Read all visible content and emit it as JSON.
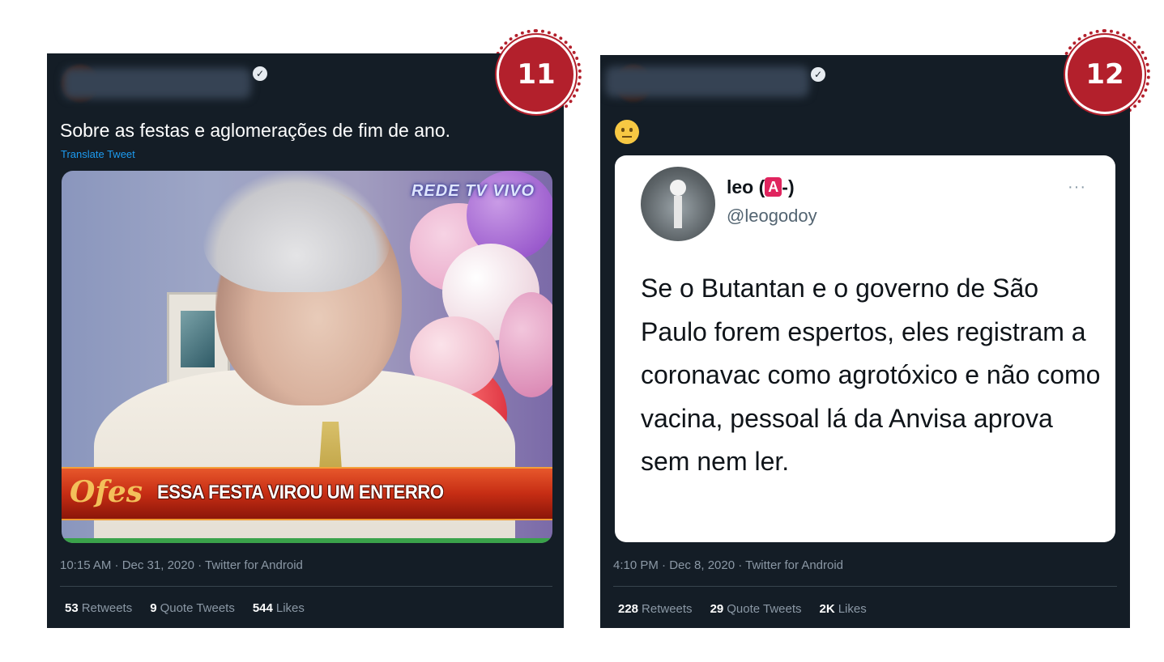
{
  "colors": {
    "card_bg": "#141d26",
    "text_primary": "#ffffff",
    "text_secondary": "#8b98a5",
    "link": "#1d9bf0",
    "badge": "#b3202c"
  },
  "tweet1": {
    "badge_number": "11",
    "text": "Sobre as festas e aglomerações de fim de ano.",
    "translate": "Translate Tweet",
    "media": {
      "tv_logo": "REDE TV VIVO",
      "banner_logo": "Ofes",
      "banner_text": "ESSA FESTA VIROU UM ENTERRO"
    },
    "timestamp": "10:15 AM · Dec 31, 2020 · Twitter for Android",
    "stats": {
      "retweets_count": "53",
      "retweets_label": "Retweets",
      "quotes_count": "9",
      "quotes_label": "Quote Tweets",
      "likes_count": "544",
      "likes_label": "Likes"
    }
  },
  "tweet2": {
    "badge_number": "12",
    "emoji": "neutral-face",
    "quoted": {
      "name": "leo (",
      "name_badge": "A",
      "name_suffix": "-)",
      "handle": "@leogodoy",
      "more": "···",
      "text": "Se o Butantan e o governo de São Paulo forem espertos, eles registram a coronavac como agrotóxico e não como vacina, pessoal lá da Anvisa aprova sem nem ler."
    },
    "timestamp": "4:10 PM · Dec 8, 2020 · Twitter for Android",
    "stats": {
      "retweets_count": "228",
      "retweets_label": "Retweets",
      "quotes_count": "29",
      "quotes_label": "Quote Tweets",
      "likes_count": "2K",
      "likes_label": "Likes"
    }
  }
}
